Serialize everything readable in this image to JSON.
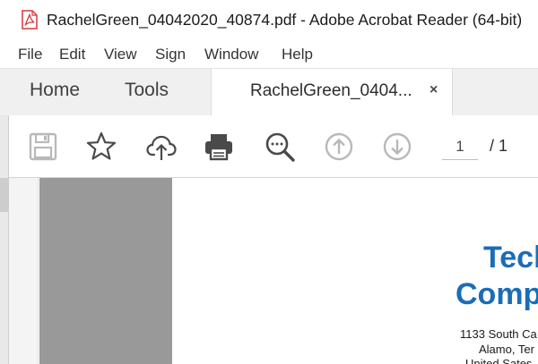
{
  "window": {
    "title": "RachelGreen_04042020_40874.pdf - Adobe Acrobat Reader (64-bit)",
    "file_icon": "pdf-file-icon"
  },
  "menu": {
    "items": [
      "File",
      "Edit",
      "View",
      "Sign",
      "Window",
      "Help"
    ]
  },
  "tabs": {
    "home": "Home",
    "tools": "Tools",
    "document": "RachelGreen_0404...",
    "close_glyph": "×"
  },
  "toolbar": {
    "icons": [
      "save-icon",
      "bookmark-star-icon",
      "upload-cloud-icon",
      "print-icon",
      "find-zoom-icon",
      "previous-page-icon",
      "next-page-icon"
    ],
    "current_page": "1",
    "page_total": "/ 1"
  },
  "document": {
    "company_line1": "Tecl",
    "company_line2": "Comp",
    "address_line1": "1133 South Ca",
    "address_line2": "Alamo, Ter",
    "address_line3": "United Sates"
  },
  "colors": {
    "brand_blue": "#1a6db8",
    "pdf_red": "#d7373f",
    "tab_bar_bg": "#f0f0f0",
    "gray_column": "#999999"
  }
}
